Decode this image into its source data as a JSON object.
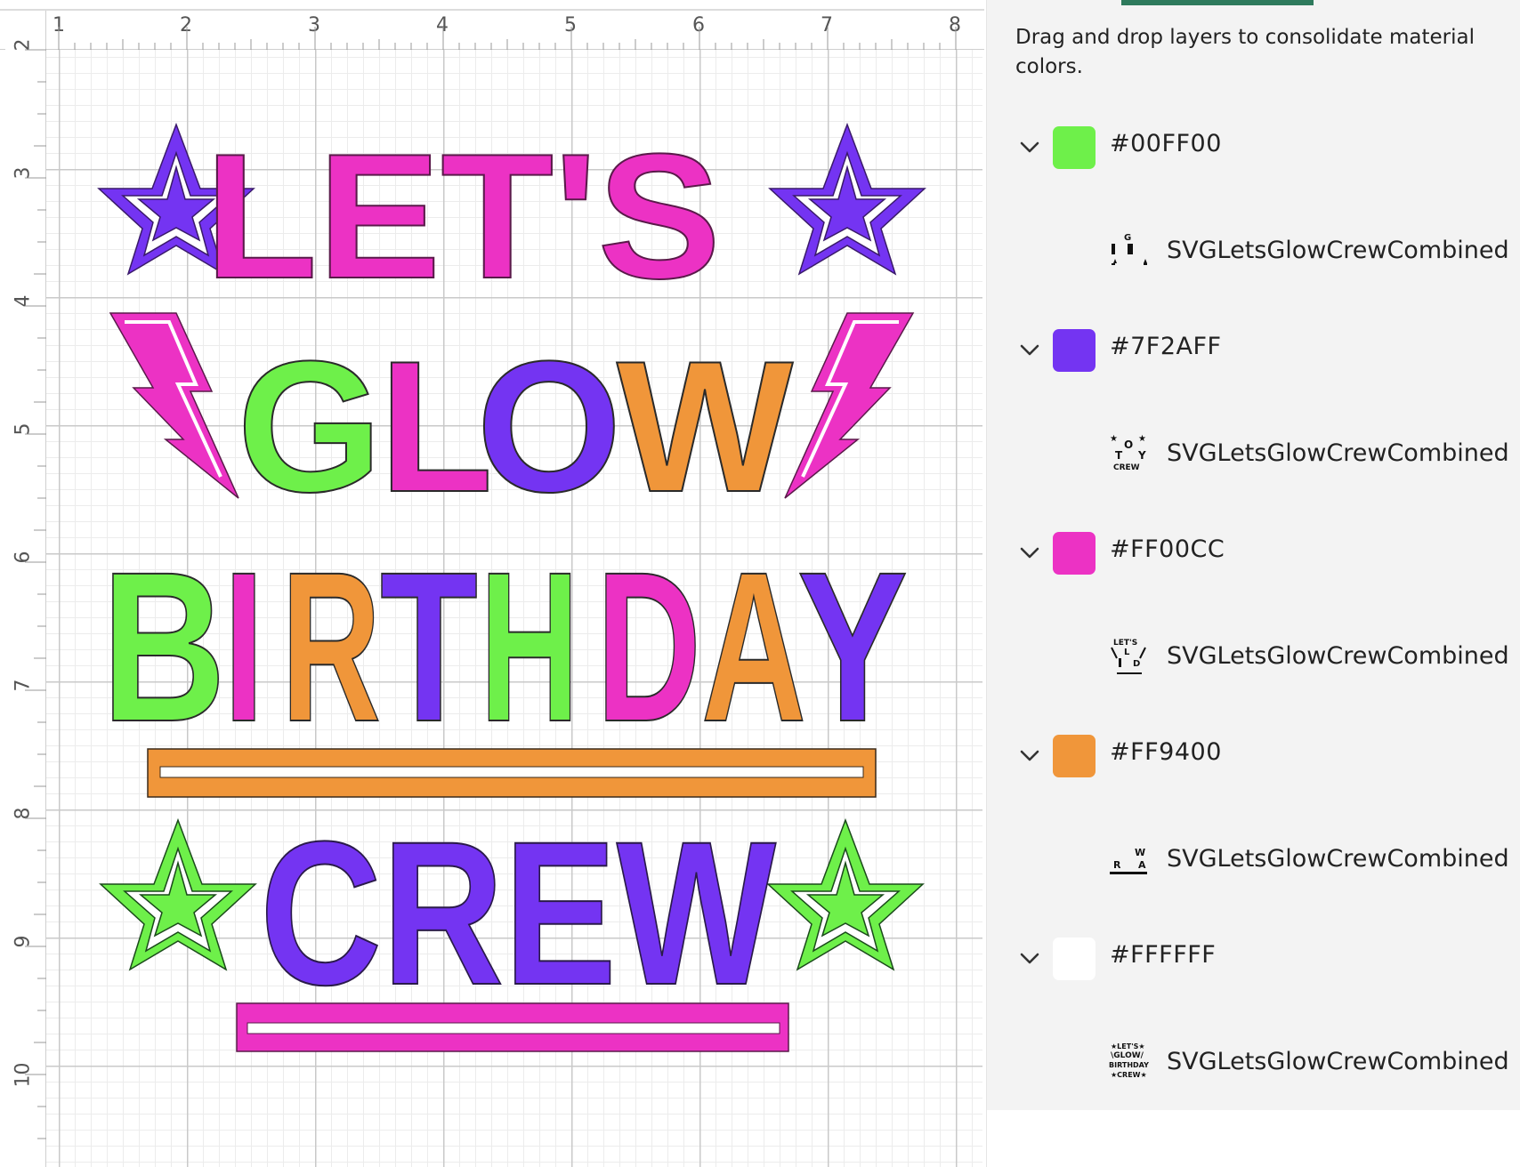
{
  "ruler": {
    "horizontal": [
      "1",
      "2",
      "3",
      "4",
      "5",
      "6",
      "7",
      "8"
    ],
    "vertical": [
      "2",
      "3",
      "4",
      "5",
      "6",
      "7",
      "8",
      "9",
      "10"
    ]
  },
  "design": {
    "line1": "LET'S",
    "line2": "GLOW",
    "line3": "BIRTHDAY",
    "line4": "CREW",
    "colors": {
      "green": "#00FF00",
      "purple": "#7F2AFF",
      "pink": "#FF00CC",
      "orange": "#FF9400",
      "white": "#FFFFFF"
    }
  },
  "panel": {
    "hint": "Drag and drop layers to consolidate material colors.",
    "groups": [
      {
        "hex": "#00FF00",
        "swatch": "#6EF04A",
        "layer": "SVGLetsGlowCrewCombined",
        "thumb_icon": "layer-thumbnail-icon"
      },
      {
        "hex": "#7F2AFF",
        "swatch": "#7434F2",
        "layer": "SVGLetsGlowCrewCombined",
        "thumb_icon": "layer-thumbnail-icon"
      },
      {
        "hex": "#FF00CC",
        "swatch": "#EC32C4",
        "layer": "SVGLetsGlowCrewCombined",
        "thumb_icon": "layer-thumbnail-icon"
      },
      {
        "hex": "#FF9400",
        "swatch": "#F0963A",
        "layer": "SVGLetsGlowCrewCombined",
        "thumb_icon": "layer-thumbnail-icon"
      },
      {
        "hex": "#FFFFFF",
        "swatch": "#FFFFFF",
        "layer": "SVGLetsGlowCrewCombined",
        "thumb_icon": "layer-thumbnail-icon"
      }
    ]
  }
}
